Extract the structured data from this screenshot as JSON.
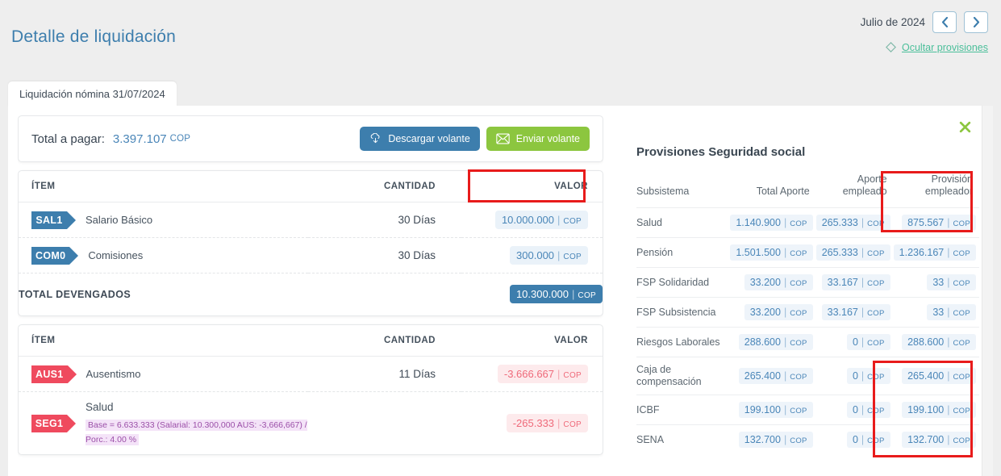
{
  "header": {
    "title": "Detalle de liquidación",
    "period": "Julio de 2024",
    "prev_icon": "chevron-left-icon",
    "next_icon": "chevron-right-icon",
    "hide_provisions": "Ocultar provisiones",
    "tag_icon": "tag-icon"
  },
  "tab": {
    "label": "Liquidación nómina 31/07/2024"
  },
  "summary": {
    "total_label": "Total a pagar:",
    "total_value": "3.397.107",
    "currency": "COP",
    "download_label": "Descargar volante",
    "download_icon": "cloud-download-icon",
    "send_label": "Enviar volante",
    "send_icon": "envelope-icon"
  },
  "earnings": {
    "columns": {
      "item": "ÍTEM",
      "quantity": "CANTIDAD",
      "value": "VALOR"
    },
    "rows": [
      {
        "code": "SAL1",
        "name": "Salario Básico",
        "qty": "30",
        "unit": "Días",
        "value": "10.000.000",
        "currency": "COP"
      },
      {
        "code": "COM0",
        "name": "Comisiones",
        "qty": "30",
        "unit": "Días",
        "value": "300.000",
        "currency": "COP"
      }
    ],
    "total_label": "TOTAL DEVENGADOS",
    "total_value": "10.300.000",
    "total_currency": "COP"
  },
  "deductions": {
    "columns": {
      "item": "ÍTEM",
      "quantity": "CANTIDAD",
      "value": "VALOR"
    },
    "rows": [
      {
        "code": "AUS1",
        "name": "Ausentismo",
        "qty": "11",
        "unit": "Días",
        "value": "-3.666.667",
        "currency": "COP",
        "note": ""
      },
      {
        "code": "SEG1",
        "name": "Salud",
        "qty": "",
        "unit": "",
        "value": "-265.333",
        "currency": "COP",
        "note": "Base = 6.633.333 (Salarial: 10.300,000 AUS: -3,666,667) / Porc.: 4.00 %"
      }
    ]
  },
  "provisions": {
    "close_icon": "close-icon",
    "title": "Provisiones Seguridad social",
    "columns": {
      "subsystem": "Subsistema",
      "total_aporte": "Total Aporte",
      "aporte_empleado": "Aporte empleado",
      "provision_empleador": "Provisión empleador"
    },
    "currency": "COP",
    "rows": [
      {
        "subsystem": "Salud",
        "total": "1.140.900",
        "employee": "265.333",
        "employer": "875.567"
      },
      {
        "subsystem": "Pensión",
        "total": "1.501.500",
        "employee": "265.333",
        "employer": "1.236.167"
      },
      {
        "subsystem": "FSP Solidaridad",
        "total": "33.200",
        "employee": "33.167",
        "employer": "33"
      },
      {
        "subsystem": "FSP Subsistencia",
        "total": "33.200",
        "employee": "33.167",
        "employer": "33"
      },
      {
        "subsystem": "Riesgos Laborales",
        "total": "288.600",
        "employee": "0",
        "employer": "288.600"
      },
      {
        "subsystem": "Caja de compensación",
        "total": "265.400",
        "employee": "0",
        "employer": "265.400"
      },
      {
        "subsystem": "ICBF",
        "total": "199.100",
        "employee": "0",
        "employer": "199.100"
      },
      {
        "subsystem": "SENA",
        "total": "132.700",
        "employee": "0",
        "employer": "132.700"
      }
    ]
  },
  "colors": {
    "accent_blue": "#3d7ead",
    "accent_green": "#8cc63f",
    "teal_link": "#4bbf9a",
    "badge_red": "#ef4a5e",
    "highlight_red": "#e81b1b"
  }
}
